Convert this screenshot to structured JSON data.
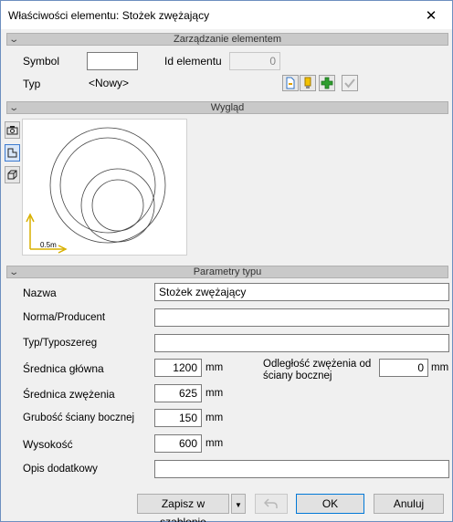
{
  "window": {
    "title": "Właściwości elementu: Stożek zwężający",
    "close_icon": "close-icon"
  },
  "sections": {
    "management": "Zarządzanie elementem",
    "appearance": "Wygląd",
    "type_params": "Parametry typu"
  },
  "management": {
    "symbol_label": "Symbol",
    "symbol_value": "",
    "id_label": "Id elementu",
    "id_value": "0",
    "type_label": "Typ",
    "type_value": "<Nowy>"
  },
  "preview": {
    "scale_label": "0.5m"
  },
  "params": {
    "name_label": "Nazwa",
    "name_value": "Stożek zwężający",
    "norm_label": "Norma/Producent",
    "norm_value": "",
    "series_label": "Typ/Typoszereg",
    "series_value": "",
    "main_diameter_label": "Średnica główna",
    "main_diameter_value": "1200",
    "main_diameter_unit": "mm",
    "narrow_diameter_label": "Średnica zwężenia",
    "narrow_diameter_value": "625",
    "narrow_diameter_unit": "mm",
    "wall_thickness_label": "Grubość ściany bocznej",
    "wall_thickness_value": "150",
    "wall_thickness_unit": "mm",
    "height_label": "Wysokość",
    "height_value": "600",
    "height_unit": "mm",
    "offset_label_line1": "Odległość zwężenia od",
    "offset_label_line2": "ściany bocznej",
    "offset_value": "0",
    "offset_unit": "mm",
    "extra_label": "Opis dodatkowy",
    "extra_value": ""
  },
  "footer": {
    "save_template": "Zapisz w szablonie",
    "ok": "OK",
    "cancel": "Anuluj"
  },
  "colors": {
    "accent": "#0078d7",
    "plus_green": "#2f9e2f",
    "axis_yellow": "#d8b000"
  }
}
